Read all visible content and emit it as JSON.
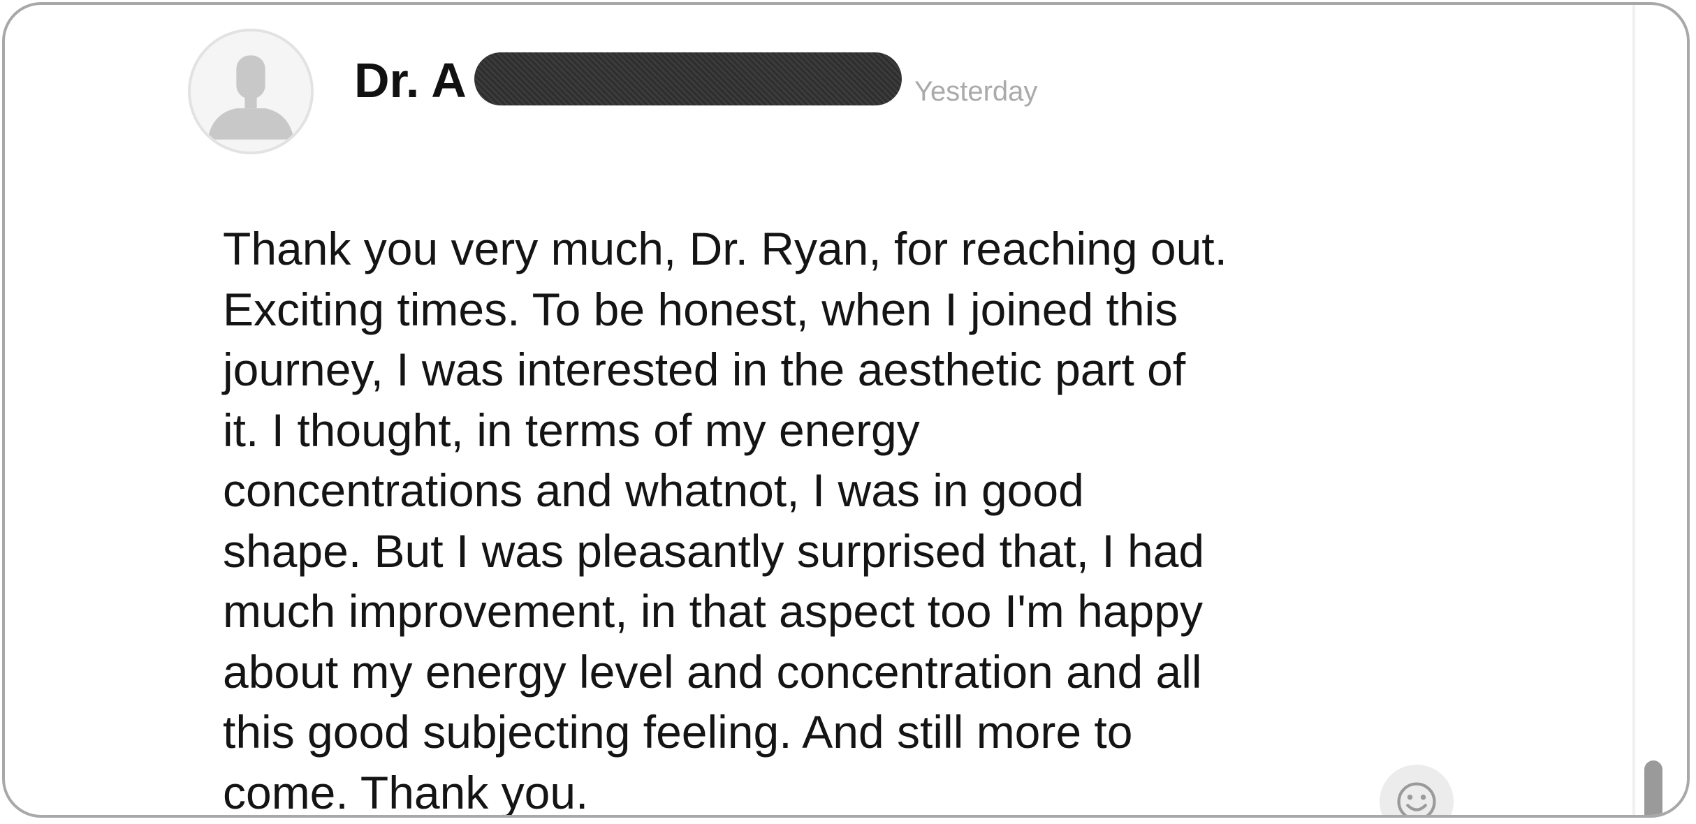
{
  "message": {
    "author": "Dr. A",
    "timestamp": "Yesterday",
    "lines": [
      "Thank you very much, Dr. Ryan, for reaching out.",
      "Exciting times. To be honest, when I joined this",
      "journey, I was interested in the aesthetic part of",
      "it. I thought, in terms of my energy",
      "concentrations and whatnot, I was in good",
      "shape. But I was pleasantly surprised that, I had",
      "much improvement, in that aspect too I'm happy",
      "about my energy level and concentration and all",
      "this good subjecting feeling. And still more to",
      "come. Thank you."
    ]
  },
  "icons": {
    "avatar": "default-user-avatar-icon",
    "emoji": "smiley-icon"
  }
}
